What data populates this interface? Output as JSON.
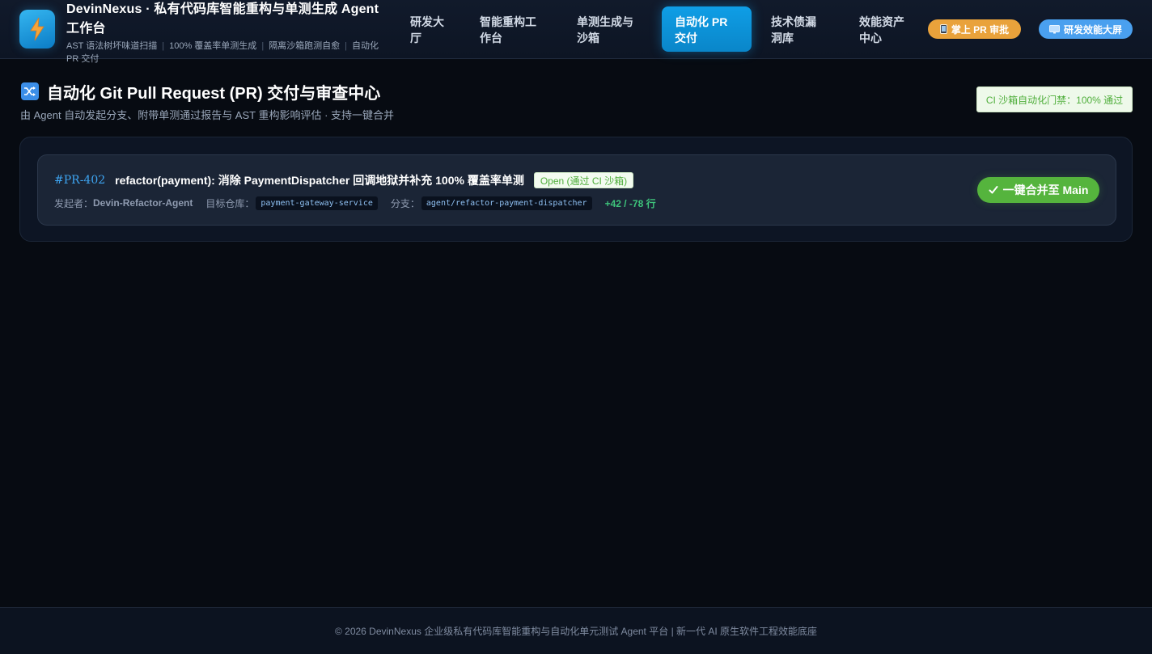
{
  "header": {
    "brand_title": "DevinNexus · 私有代码库智能重构与单测生成 Agent 工作台",
    "brand_sub": [
      "AST 语法树坏味道扫描",
      "100% 覆盖率单测生成",
      "隔离沙箱跑测自愈",
      "自动化 PR 交付"
    ],
    "nav": [
      {
        "label": "研发大厅",
        "active": false
      },
      {
        "label": "智能重构工作台",
        "active": false
      },
      {
        "label": "单测生成与沙箱",
        "active": false
      },
      {
        "label": "自动化 PR 交付",
        "active": true
      },
      {
        "label": "技术债漏洞库",
        "active": false
      },
      {
        "label": "效能资产中心",
        "active": false
      }
    ],
    "pill_pr_review": {
      "label": "掌上 PR 审批",
      "icon": "mobile-phone-icon"
    },
    "pill_dashboard": {
      "label": "研发效能大屏",
      "icon": "monitor-icon"
    }
  },
  "page": {
    "title": "自动化 Git Pull Request (PR) 交付与审查中心",
    "title_icon": "shuffle-icon",
    "subtitle": "由 Agent 自动发起分支、附带单测通过报告与 AST 重构影响评估 · 支持一键合并",
    "ci_badge": "CI 沙箱自动化门禁：100% 通过"
  },
  "pr": {
    "id": "#PR-402",
    "title": "refactor(payment): 消除 PaymentDispatcher 回调地狱并补充 100% 覆盖率单测",
    "status": "Open (通过 CI 沙箱)",
    "author_label": "发起者：",
    "author": "Devin-Refactor-Agent",
    "repo_label": "目标仓库：",
    "repo": "payment-gateway-service",
    "branch_label": "分支：",
    "branch": "agent/refactor-payment-dispatcher",
    "diff": "+42 / -78 行",
    "merge_label": "一键合并至 Main",
    "merge_icon": "checkmark-icon"
  },
  "footer": {
    "text": "© 2026 DevinNexus 企业级私有代码库智能重构与自动化单元测试 Agent 平台 | 新一代 AI 原生软件工程效能底座"
  },
  "colors": {
    "accent": "#0f9ee6",
    "merge_green": "#55b43d",
    "pill_orange": "#e9a23b",
    "pill_blue": "#4aa0ef",
    "status_green": "#4fae3b"
  }
}
